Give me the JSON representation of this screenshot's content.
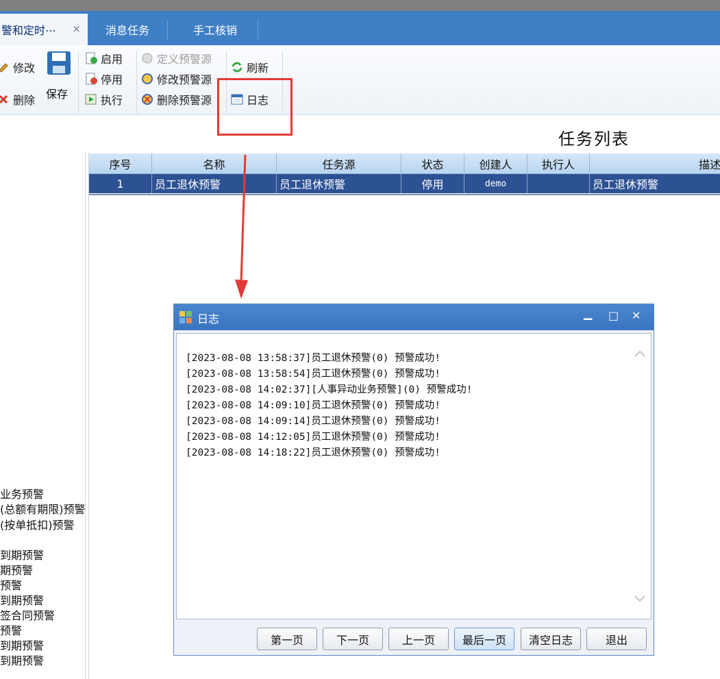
{
  "tabs": [
    {
      "label": "警和定时⋯",
      "close": "×"
    },
    {
      "label": "消息任务"
    },
    {
      "label": "手工核销"
    }
  ],
  "toolbar": {
    "edit": "修改",
    "delete": "删除",
    "save": "保存",
    "enable": "启用",
    "disable": "停用",
    "execute": "执行",
    "define_source": "定义预警源",
    "modify_source": "修改预警源",
    "delete_source": "删除预警源",
    "refresh": "刷新",
    "log": "日志"
  },
  "task_list": {
    "title": "任务列表",
    "columns": [
      "序号",
      "名称",
      "任务源",
      "状态",
      "创建人",
      "执行人",
      "描述"
    ],
    "rows": [
      {
        "seq": "1",
        "name": "员工退休预警",
        "source": "员工退休预警",
        "status": "停用",
        "creator": "demo",
        "executor": "",
        "desc": "员工退休预警"
      }
    ]
  },
  "tree": {
    "items": [
      "业务预警",
      "(总额有期限)预警",
      "(按单抵扣)预警",
      "到期预警",
      "期预警",
      "预警",
      "到期预警",
      "签合同预警",
      "预警",
      "到期预警",
      "到期预警"
    ]
  },
  "dialog": {
    "title": "日志",
    "minimize": "▁",
    "maximize": "□",
    "close": "✕",
    "lines": [
      "[2023-08-08 13:58:37]员工退休预警(0) 预警成功!",
      "[2023-08-08 13:58:54]员工退休预警(0) 预警成功!",
      "[2023-08-08 14:02:37][人事异动业务预警](0) 预警成功!",
      "[2023-08-08 14:09:10]员工退休预警(0) 预警成功!",
      "[2023-08-08 14:09:14]员工退休预警(0) 预警成功!",
      "[2023-08-08 14:12:05]员工退休预警(0) 预警成功!",
      "[2023-08-08 14:18:22]员工退休预警(0) 预警成功!"
    ],
    "buttons": {
      "first": "第一页",
      "next": "下一页",
      "prev": "上一页",
      "last": "最后一页",
      "clear": "清空日志",
      "exit": "退出"
    }
  },
  "colors": {
    "tabbar": "#3f7fc6",
    "selected_row": "#2d5294",
    "highlight": "#e53935"
  }
}
